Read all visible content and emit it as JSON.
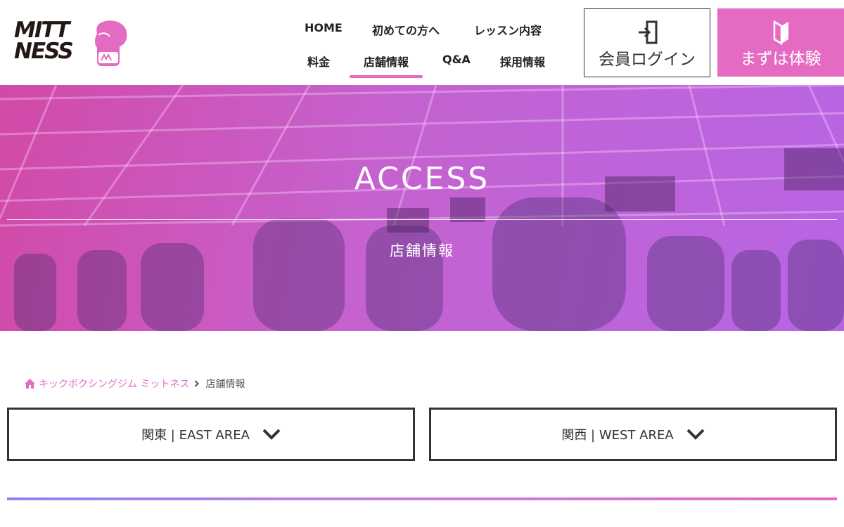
{
  "brand": {
    "line1": "MITT",
    "line2": "NESS",
    "accent": "#e46ac2"
  },
  "nav": {
    "items": [
      {
        "label": "HOME"
      },
      {
        "label": "初めての方へ"
      },
      {
        "label": "レッスン内容"
      },
      {
        "label": "料金"
      },
      {
        "label": "店舗情報",
        "active": true
      },
      {
        "label": "Q&A"
      },
      {
        "label": "採用情報"
      }
    ]
  },
  "header_buttons": {
    "login": {
      "label": "会員ログイン",
      "icon": "login-door-icon"
    },
    "trial": {
      "label": "まずは体験",
      "icon": "beginner-mark-icon"
    }
  },
  "hero": {
    "title": "ACCESS",
    "subtitle": "店舗情報"
  },
  "breadcrumb": {
    "home_icon": "home-icon",
    "home": "キックボクシングジム ミットネス",
    "separator_icon": "chevron-right-icon",
    "current": "店舗情報"
  },
  "areas": {
    "east": {
      "label": "関東 | EAST AREA",
      "icon": "chevron-down-icon"
    },
    "west": {
      "label": "関西 | WEST AREA",
      "icon": "chevron-down-icon"
    }
  },
  "colors": {
    "accent": "#e46ac2",
    "divider_start": "#8c83f2",
    "divider_end": "#e46ac2"
  }
}
